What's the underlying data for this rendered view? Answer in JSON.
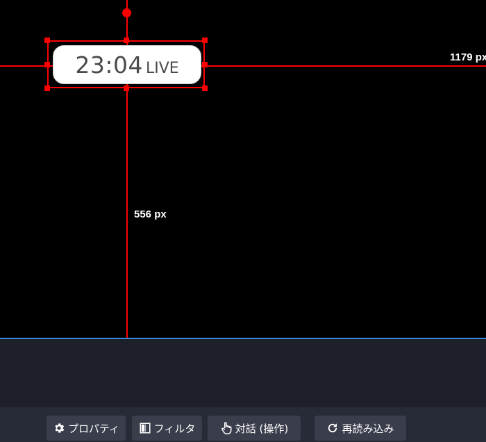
{
  "canvas": {
    "clock_time": "23:04",
    "clock_live": "LIVE",
    "width_label": "1179 px",
    "height_label": "556 px"
  },
  "toolbar": {
    "properties_label": "プロパティ",
    "filter_label": "フィルタ",
    "interact_label": "対話 (操作)",
    "reload_label": "再読み込み"
  },
  "colors": {
    "guide": "#ff0000",
    "selection_bar": "#3a8be0",
    "panel": "#1d1f2a",
    "toolbar": "#272a37",
    "button": "#3a3d4b"
  }
}
